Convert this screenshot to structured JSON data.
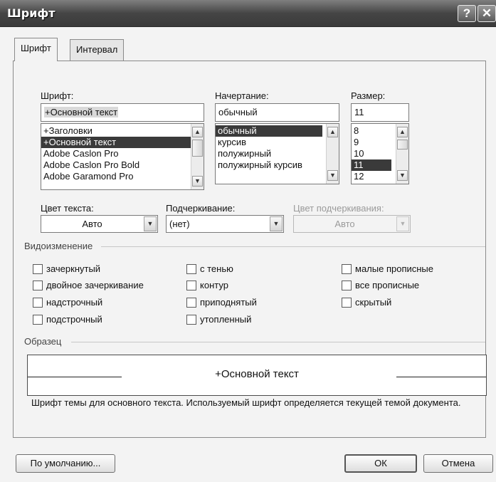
{
  "window": {
    "title": "Шрифт",
    "help_label": "?",
    "close_label": "✕"
  },
  "tabs": [
    "Шрифт",
    "Интервал"
  ],
  "font": {
    "label": "Шрифт:",
    "value": "+Основной текст",
    "items": [
      "+Заголовки",
      "+Основной текст",
      "Adobe Caslon Pro",
      "Adobe Caslon Pro Bold",
      "Adobe Garamond Pro"
    ],
    "selected_index": 1
  },
  "style": {
    "label": "Начертание:",
    "value": "обычный",
    "items": [
      "обычный",
      "курсив",
      "полужирный",
      "полужирный курсив"
    ],
    "selected_index": 0
  },
  "size": {
    "label": "Размер:",
    "value": "11",
    "items": [
      "8",
      "9",
      "10",
      "11",
      "12"
    ],
    "selected_index": 3
  },
  "font_color": {
    "label": "Цвет текста:",
    "value": "Авто"
  },
  "underline": {
    "label": "Подчеркивание:",
    "value": "(нет)"
  },
  "underline_color": {
    "label": "Цвет подчеркивания:",
    "value": "Авто"
  },
  "effects": {
    "title": "Видоизменение",
    "col1": [
      "зачеркнутый",
      "двойное зачеркивание",
      "надстрочный",
      "подстрочный"
    ],
    "col2": [
      "с тенью",
      "контур",
      "приподнятый",
      "утопленный"
    ],
    "col3": [
      "малые прописные",
      "все прописные",
      "скрытый"
    ]
  },
  "preview": {
    "title": "Образец",
    "text": "+Основной текст",
    "description": "Шрифт темы для основного текста. Используемый шрифт определяется текущей темой документа."
  },
  "buttons": {
    "default": "По умолчанию...",
    "ok": "ОК",
    "cancel": "Отмена"
  }
}
